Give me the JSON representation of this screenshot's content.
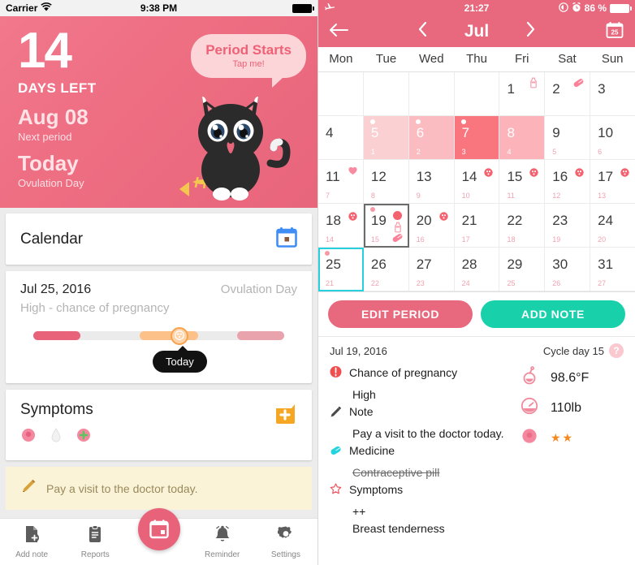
{
  "left": {
    "status": {
      "carrier": "Carrier",
      "wifi_icon": "wifi-icon",
      "time": "9:38 PM",
      "battery_icon": "battery-full-icon"
    },
    "hero": {
      "days_number": "14",
      "days_left_label": "DAYS LEFT",
      "next_date": "Aug 08",
      "next_label": "Next period",
      "today_title": "Today",
      "today_label": "Ovulation Day",
      "bubble_title": "Period Starts",
      "bubble_sub": "Tap me!",
      "mascot_icon": "black-cat-mascot",
      "fish_icon": "fishbone-icon",
      "bg_color": "#ee6e82"
    },
    "calendar_card": {
      "title": "Calendar",
      "icon": "calendar-icon",
      "icon_color": "#3f8df5"
    },
    "detail_card": {
      "date": "Jul 25, 2016",
      "phase": "Ovulation Day",
      "subtitle": "High - chance of pregnancy",
      "today_pill": "Today",
      "segments": [
        {
          "name": "period",
          "color": "#e8627a"
        },
        {
          "name": "fertile",
          "color": "#fcc089"
        },
        {
          "name": "next-period",
          "color": "#e9a3ad"
        }
      ],
      "knob_icon": "ovulation-knob-icon"
    },
    "symptoms_card": {
      "title": "Symptoms",
      "icons": [
        "breast-tenderness-icon",
        "discharge-icon",
        "add-symptom-icon"
      ],
      "action_icon": "medicine-bag-icon",
      "action_color": "#f5a623"
    },
    "note_banner": {
      "icon": "pencil-icon",
      "text": "Pay a visit to the doctor today."
    },
    "tabs": [
      {
        "label": "Add note",
        "icon": "add-note-icon"
      },
      {
        "label": "Reports",
        "icon": "clipboard-icon"
      },
      {
        "label": "",
        "icon": "calendar-fab-icon"
      },
      {
        "label": "Reminder",
        "icon": "bell-icon"
      },
      {
        "label": "Settings",
        "icon": "gear-icon"
      }
    ],
    "fab_color": "#e8627a"
  },
  "right": {
    "status": {
      "airplane_icon": "airplane-mode-icon",
      "time": "21:27",
      "icons": [
        "location-icon",
        "alarm-icon"
      ],
      "battery_percent": "86 %",
      "battery_icon": "battery-full-icon"
    },
    "nav": {
      "back_icon": "arrow-left-icon",
      "prev_icon": "chevron-left-icon",
      "month": "Jul",
      "next_icon": "chevron-right-icon",
      "today_icon": "calendar-25-icon",
      "bar_color": "#e8687e"
    },
    "weekdays": [
      "Mon",
      "Tue",
      "Wed",
      "Thu",
      "Fri",
      "Sat",
      "Sun"
    ],
    "calendar": {
      "rows": [
        [
          {
            "day": ""
          },
          {
            "day": ""
          },
          {
            "day": ""
          },
          {
            "day": ""
          },
          {
            "day": "1",
            "icon": "note-ink-icon"
          },
          {
            "day": "2",
            "icon": "pill-icon"
          },
          {
            "day": "3"
          }
        ],
        [
          {
            "day": "4"
          },
          {
            "day": "5",
            "cycle": "1",
            "period": true,
            "shade": "#fbd0d3",
            "dot": "#ffffff"
          },
          {
            "day": "6",
            "cycle": "2",
            "period": true,
            "shade": "#fbbcc1",
            "dot": "#ffffff"
          },
          {
            "day": "7",
            "cycle": "3",
            "period": true,
            "shade": "#f9767f",
            "dot": "#ffffff"
          },
          {
            "day": "8",
            "cycle": "4",
            "period": true,
            "shade": "#fcb4ba",
            "dot": ""
          },
          {
            "day": "9",
            "cycle": "5"
          },
          {
            "day": "10",
            "cycle": "6"
          }
        ],
        [
          {
            "day": "11",
            "cycle": "7",
            "icon": "heart-icon"
          },
          {
            "day": "12",
            "cycle": "8"
          },
          {
            "day": "13",
            "cycle": "9"
          },
          {
            "day": "14",
            "cycle": "10",
            "icon": "fertile-icon"
          },
          {
            "day": "15",
            "cycle": "11",
            "icon": "fertile-icon"
          },
          {
            "day": "16",
            "cycle": "12",
            "icon": "fertile-icon"
          },
          {
            "day": "17",
            "cycle": "13",
            "icon": "fertile-icon"
          }
        ],
        [
          {
            "day": "18",
            "cycle": "14",
            "icon": "fertile-icon"
          },
          {
            "day": "19",
            "cycle": "15",
            "focus": true,
            "dot": "#f79aa8",
            "bigdot": "#f4616f",
            "icon2": "note-ink-icon",
            "icon3": "pill-icon"
          },
          {
            "day": "20",
            "cycle": "16",
            "icon": "fertile-icon"
          },
          {
            "day": "21",
            "cycle": "17"
          },
          {
            "day": "22",
            "cycle": "18"
          },
          {
            "day": "23",
            "cycle": "19"
          },
          {
            "day": "24",
            "cycle": "20"
          }
        ],
        [
          {
            "day": "25",
            "cycle": "21",
            "selected": true,
            "dot": "#f79aa8"
          },
          {
            "day": "26",
            "cycle": "22"
          },
          {
            "day": "27",
            "cycle": "23"
          },
          {
            "day": "28",
            "cycle": "24"
          },
          {
            "day": "29",
            "cycle": "25"
          },
          {
            "day": "30",
            "cycle": "26"
          },
          {
            "day": "31",
            "cycle": "27"
          }
        ]
      ]
    },
    "actions": {
      "edit_label": "EDIT PERIOD",
      "edit_color": "#e8687e",
      "note_label": "ADD NOTE",
      "note_color": "#18d1ab"
    },
    "detail": {
      "date": "Jul 19, 2016",
      "cycle_day": "Cycle day 15",
      "help_badge": "?",
      "items": [
        {
          "icon": "chance-icon",
          "label": "Chance of pregnancy",
          "value": "High",
          "struck": false
        },
        {
          "icon": "pencil-icon",
          "label": "Note",
          "value": "Pay a visit to the doctor today.",
          "struck": false
        },
        {
          "icon": "pill-icon",
          "label": "Medicine",
          "value": "Contraceptive pill",
          "struck": true
        },
        {
          "icon": "star-icon",
          "label": "Symptoms",
          "value": "++\nBreast tenderness",
          "struck": false
        }
      ],
      "metrics": [
        {
          "icon": "thermometer-icon",
          "value": "98.6°F"
        },
        {
          "icon": "scale-icon",
          "value": "110lb"
        },
        {
          "icon": "breast-icon",
          "value": "★★"
        }
      ]
    }
  }
}
